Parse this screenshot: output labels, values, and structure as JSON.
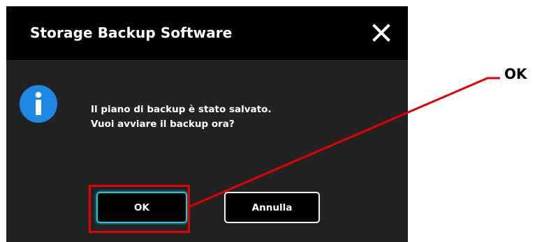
{
  "dialog": {
    "title": "Storage Backup Software",
    "message_line1": "Il piano di backup è stato salvato.",
    "message_line2": "Vuoi avviare il backup ora?",
    "ok_label": "OK",
    "cancel_label": "Annulla",
    "icons": {
      "close": "close-icon",
      "info": "info-icon"
    }
  },
  "annotation": {
    "label": "OK",
    "color": "#e20000"
  },
  "colors": {
    "titlebar": "#000000",
    "body": "#222222",
    "info_icon": "#1e88e5",
    "focus_ring": "#1ec8d8"
  }
}
